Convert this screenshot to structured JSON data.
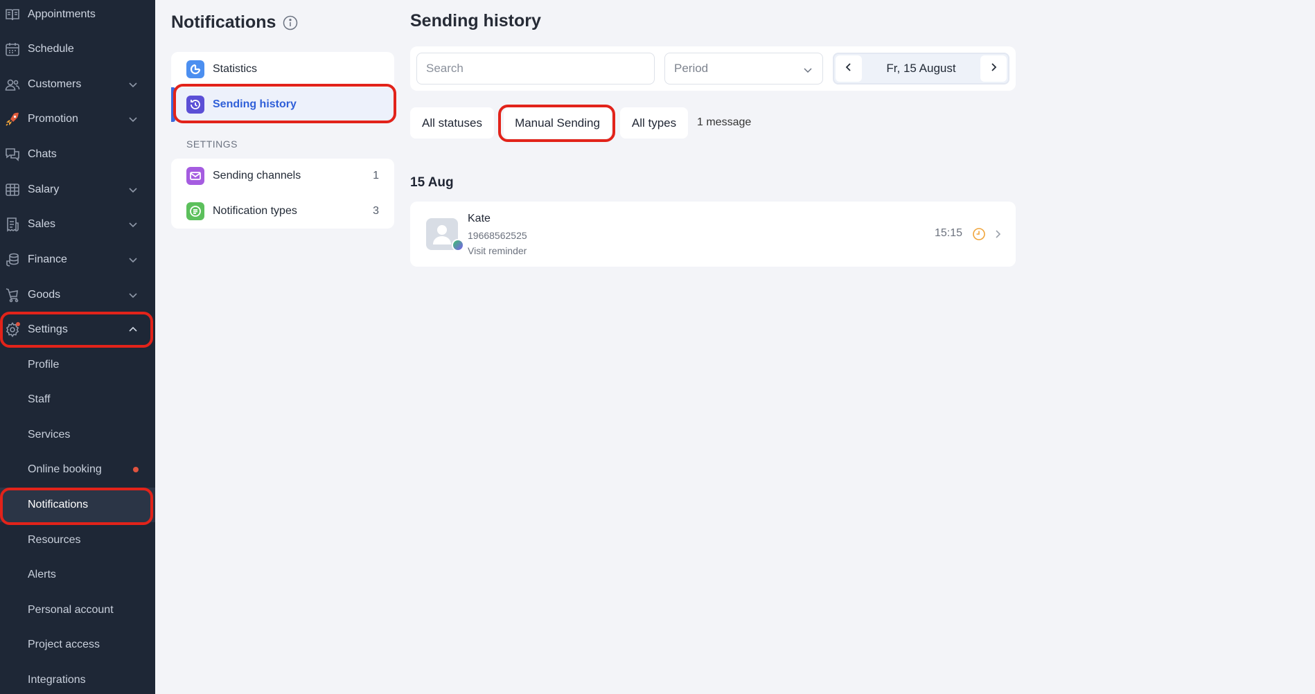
{
  "sidebar": {
    "items": [
      {
        "label": "Appointments",
        "icon": "book-icon"
      },
      {
        "label": "Schedule",
        "icon": "calendar-icon"
      },
      {
        "label": "Customers",
        "icon": "users-icon"
      },
      {
        "label": "Promotion",
        "icon": "rocket-icon"
      },
      {
        "label": "Chats",
        "icon": "chat-icon"
      },
      {
        "label": "Salary",
        "icon": "salary-grid-icon"
      },
      {
        "label": "Sales",
        "icon": "receipt-icon"
      },
      {
        "label": "Finance",
        "icon": "coins-icon"
      },
      {
        "label": "Goods",
        "icon": "cart-icon"
      },
      {
        "label": "Settings",
        "icon": "gear-icon"
      }
    ],
    "settings_sub": [
      {
        "label": "Profile"
      },
      {
        "label": "Staff"
      },
      {
        "label": "Services"
      },
      {
        "label": "Online booking"
      },
      {
        "label": "Notifications"
      },
      {
        "label": "Resources"
      },
      {
        "label": "Alerts"
      },
      {
        "label": "Personal account"
      },
      {
        "label": "Project access"
      },
      {
        "label": "Integrations"
      }
    ]
  },
  "notifications": {
    "title": "Notifications",
    "menu": [
      {
        "label": "Statistics",
        "icon": "statistics-icon"
      },
      {
        "label": "Sending history",
        "icon": "history-icon"
      }
    ],
    "settings_label": "SETTINGS",
    "settings_menu": [
      {
        "label": "Sending channels",
        "count": "1",
        "icon": "envelope-icon"
      },
      {
        "label": "Notification types",
        "count": "3",
        "icon": "list-icon"
      }
    ]
  },
  "main": {
    "title": "Sending history",
    "search_placeholder": "Search",
    "period_placeholder": "Period",
    "date_label": "Fr, 15 August",
    "filters": {
      "status": "All statuses",
      "sending": "Manual Sending",
      "types": "All types",
      "count": "1 message"
    },
    "date_heading": "15 Aug",
    "messages": [
      {
        "name": "Kate",
        "phone": "19668562525",
        "type": "Visit reminder",
        "time": "15:15",
        "status_icon": "clock-icon"
      }
    ]
  },
  "colors": {
    "sidebar_bg": "#1e2736",
    "accent": "#3c68dc",
    "highlight": "#e2231a",
    "status_pending": "#f0a43a"
  }
}
